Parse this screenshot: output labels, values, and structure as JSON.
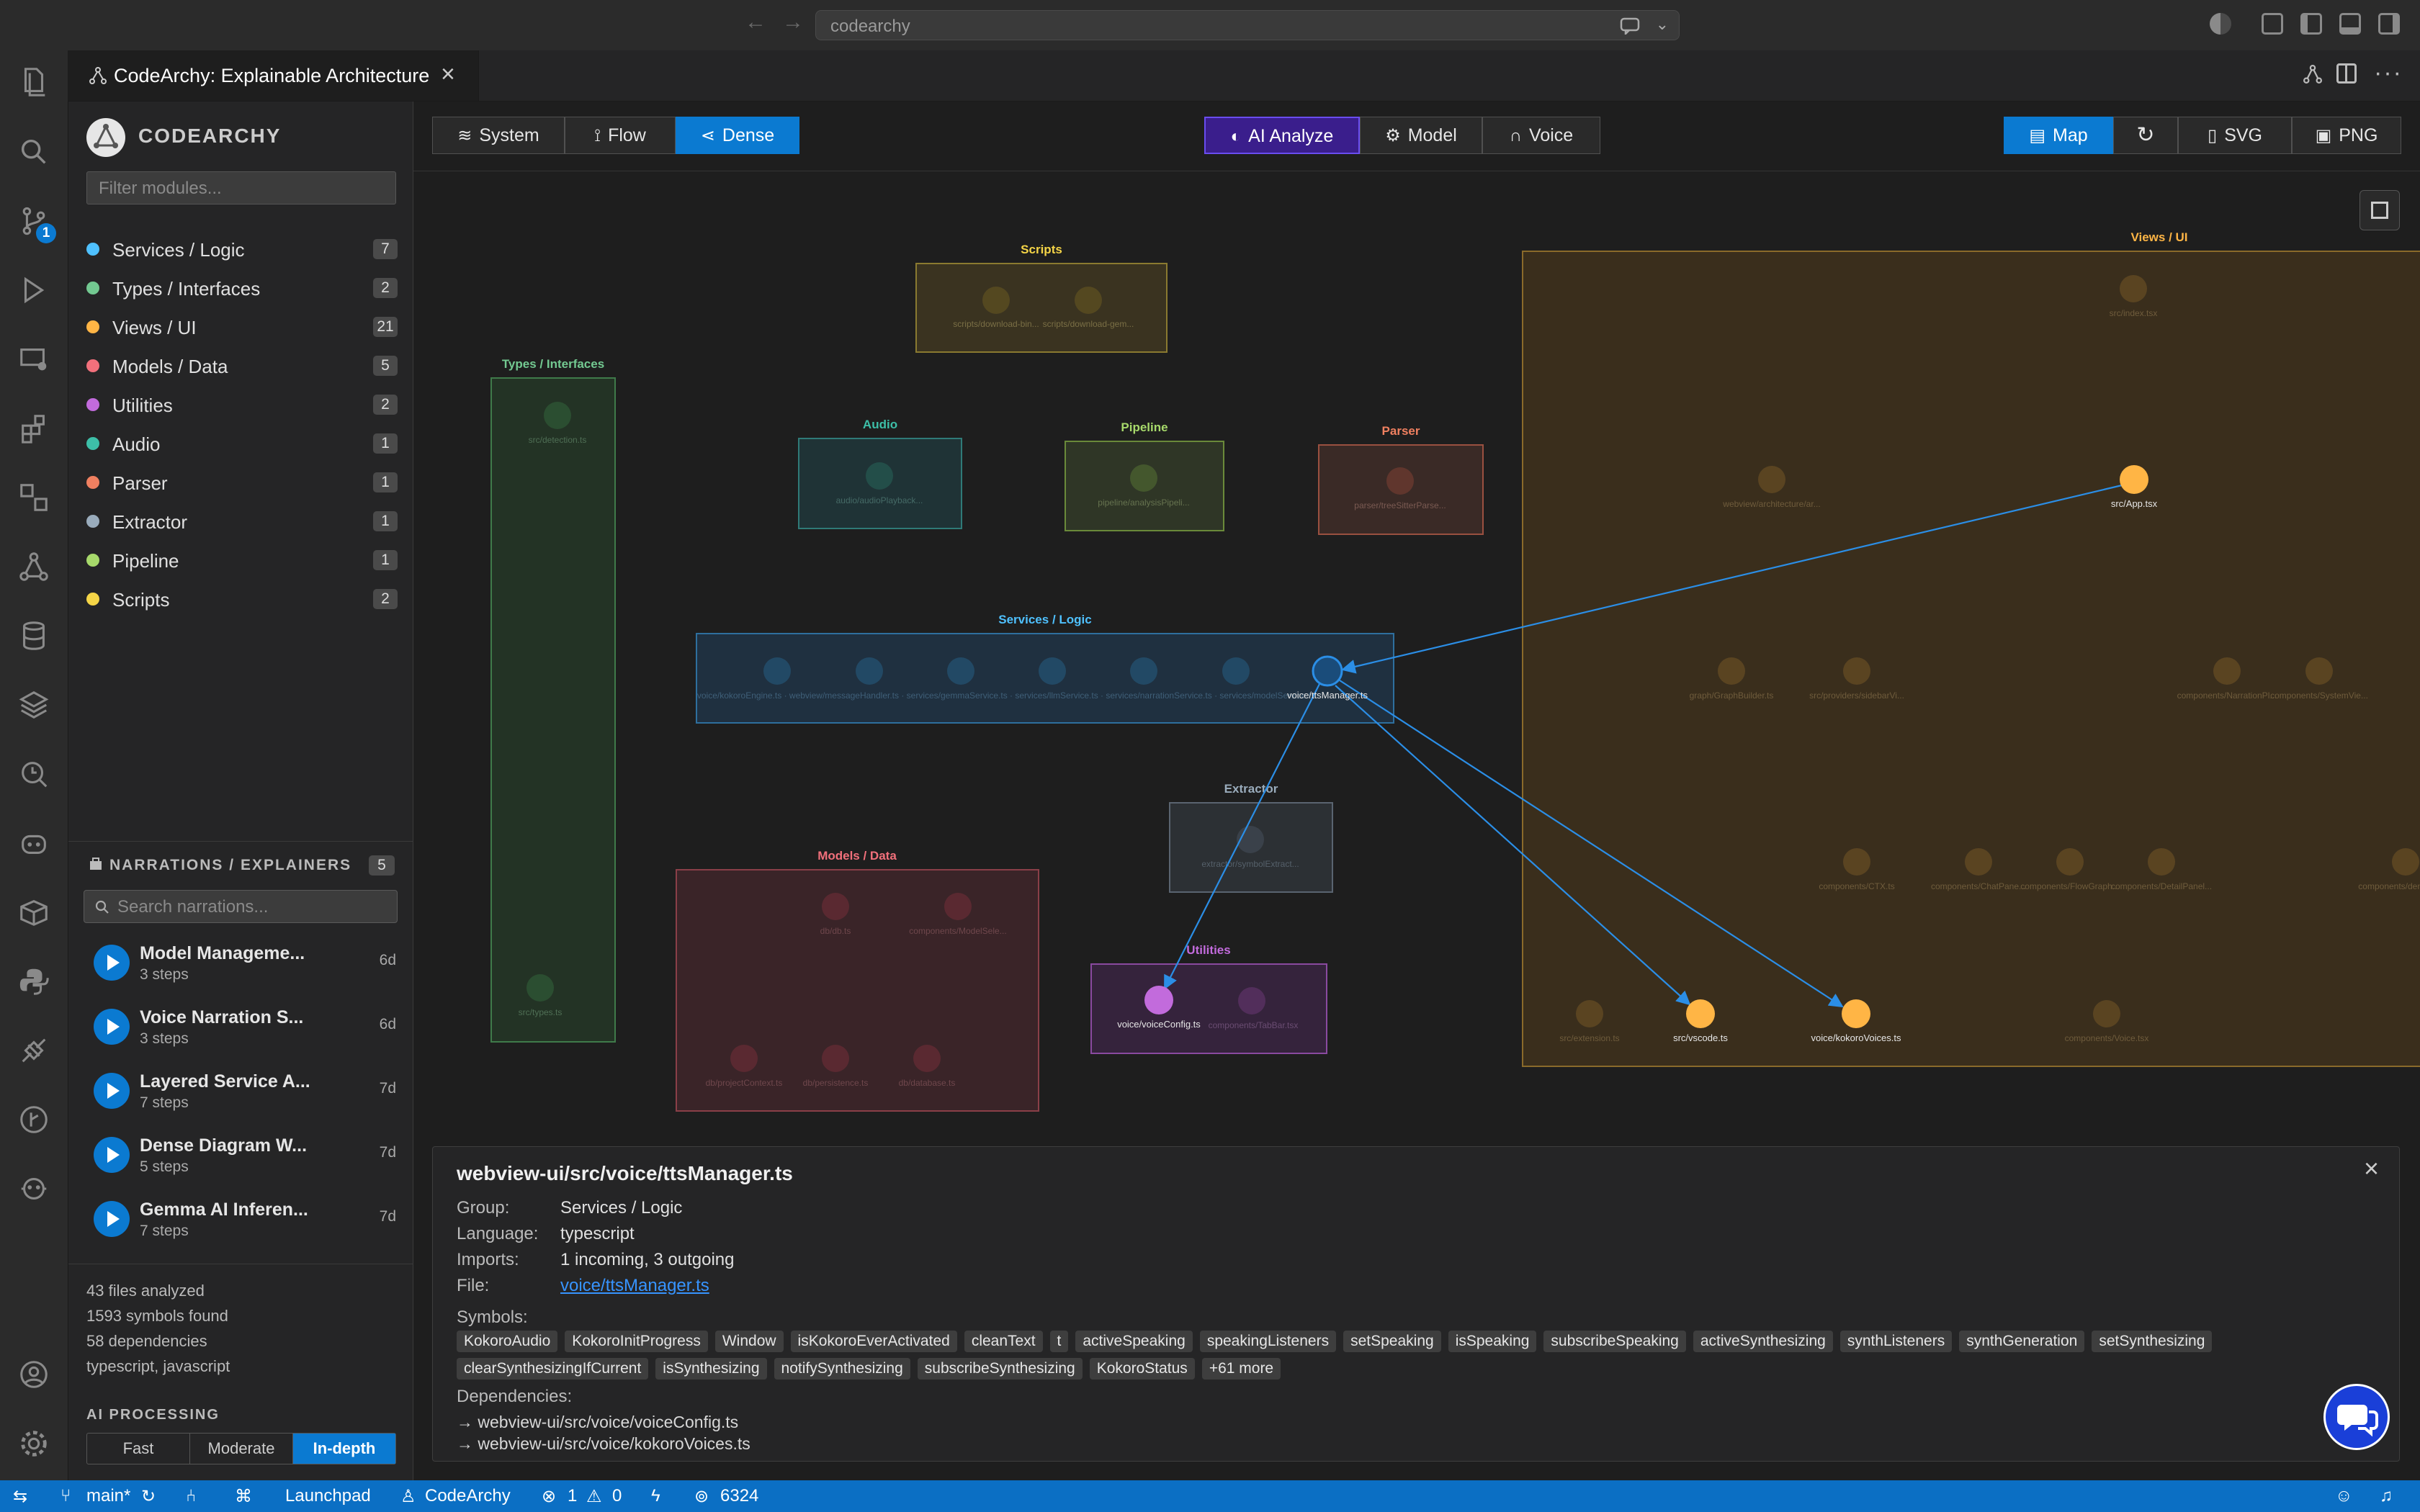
{
  "titlebar": {
    "search_text": "codearchy"
  },
  "tab": {
    "title": "CodeArchy: Explainable Architecture"
  },
  "sidebar": {
    "brand": "CODEARCHY",
    "filter_placeholder": "Filter modules...",
    "groups": [
      {
        "label": "Services / Logic",
        "count": "7",
        "color": "#4fc1ff"
      },
      {
        "label": "Types / Interfaces",
        "count": "2",
        "color": "#73c991"
      },
      {
        "label": "Views / UI",
        "count": "21",
        "color": "#ffb545"
      },
      {
        "label": "Models / Data",
        "count": "5",
        "color": "#f1707b"
      },
      {
        "label": "Utilities",
        "count": "2",
        "color": "#c26bdc"
      },
      {
        "label": "Audio",
        "count": "1",
        "color": "#3dbfa8"
      },
      {
        "label": "Parser",
        "count": "1",
        "color": "#f08060"
      },
      {
        "label": "Extractor",
        "count": "1",
        "color": "#9aacbc"
      },
      {
        "label": "Pipeline",
        "count": "1",
        "color": "#a7d96b"
      },
      {
        "label": "Scripts",
        "count": "2",
        "color": "#f5d547"
      }
    ],
    "narrations_title": "NARRATIONS / EXPLAINERS",
    "narrations_count": "5",
    "narrations_search_placeholder": "Search narrations...",
    "narrations": [
      {
        "title": "Model Manageme...",
        "steps": "3 steps",
        "age": "6d"
      },
      {
        "title": "Voice Narration S...",
        "steps": "3 steps",
        "age": "6d"
      },
      {
        "title": "Layered Service A...",
        "steps": "7 steps",
        "age": "7d"
      },
      {
        "title": "Dense Diagram W...",
        "steps": "5 steps",
        "age": "7d"
      },
      {
        "title": "Gemma AI Inferen...",
        "steps": "7 steps",
        "age": "7d"
      }
    ],
    "stats": [
      "43 files analyzed",
      "1593 symbols found",
      "58 dependencies",
      "typescript, javascript"
    ],
    "ai_processing_title": "AI PROCESSING",
    "ai_modes": [
      "Fast",
      "Moderate",
      "In-depth"
    ],
    "ai_mode_selected": "In-depth"
  },
  "toolbar": {
    "views": [
      "System",
      "Flow",
      "Dense"
    ],
    "view_selected": "Dense",
    "ai_analyze": "AI Analyze",
    "model": "Model",
    "voice": "Voice",
    "map": "Map",
    "svg": "SVG",
    "png": "PNG"
  },
  "diagram": {
    "groups": {
      "scripts": "Scripts",
      "types": "Types / Interfaces",
      "audio": "Audio",
      "pipeline": "Pipeline",
      "parser": "Parser",
      "services": "Services / Logic",
      "extractor": "Extractor",
      "models": "Models / Data",
      "utilities": "Utilities",
      "views": "Views / UI"
    },
    "nodes": {
      "tts_manager": "voice/ttsManager.ts",
      "voice_config": "voice/voiceConfig.ts",
      "app": "src/App.tsx",
      "vscode": "src/vscode.ts",
      "kokoro_voices": "voice/kokoroVoices.ts"
    },
    "faint_labels": {
      "types_1": "src/detection.ts",
      "types_2": "src/types.ts",
      "scripts_1": "scripts/download-bin...",
      "scripts_2": "scripts/download-gem...",
      "audio_1": "audio/audioPlayback...",
      "pipeline_1": "pipeline/analysisPipeli...",
      "parser_1": "parser/treeSitterParse...",
      "services_row": "voice/kokoroEngine.ts · webview/messageHandler.ts · services/gemmaService.ts · services/llmService.ts · services/narrationService.ts · services/modelService.ts",
      "extractor_1": "extractor/symbolExtract...",
      "models_1": "db/db.ts",
      "models_2": "components/ModelSele...",
      "models_3": "db/projectContext.ts",
      "models_4": "db/persistence.ts",
      "models_5": "db/database.ts",
      "utilities_2": "components/TabBar.tsx",
      "views_1": "src/index.tsx",
      "views_2": "webview/architecture/ar...",
      "views_3": "graph/GraphBuilder.ts",
      "views_4": "src/providers/sidebarVi...",
      "views_5": "components/NarrationPl...",
      "views_6": "components/SystemVie...",
      "views_7": "components/CTX.ts",
      "views_8": "components/ChatPane...",
      "views_9": "components/FlowGraph...",
      "views_10": "components/DetailPanel...",
      "views_11": "components/dense...",
      "views_12": "src/extension.ts",
      "views_13": "components/Voice.tsx"
    }
  },
  "detail": {
    "title": "webview-ui/src/voice/ttsManager.ts",
    "labels": {
      "group": "Group:",
      "language": "Language:",
      "imports": "Imports:",
      "file": "File:"
    },
    "group": "Services / Logic",
    "language": "typescript",
    "imports": "1 incoming, 3 outgoing",
    "file": "voice/ttsManager.ts",
    "symbols_title": "Symbols:",
    "symbols": [
      "KokoroAudio",
      "KokoroInitProgress",
      "Window",
      "isKokoroEverActivated",
      "cleanText",
      "t",
      "activeSpeaking",
      "speakingListeners",
      "setSpeaking",
      "isSpeaking",
      "subscribeSpeaking",
      "activeSynthesizing",
      "synthListeners",
      "synthGeneration",
      "setSynthesizing",
      "clearSynthesizingIfCurrent",
      "isSynthesizing",
      "notifySynthesizing",
      "subscribeSynthesizing",
      "KokoroStatus",
      "+61 more"
    ],
    "dependencies_title": "Dependencies:",
    "dependencies": [
      "→ webview-ui/src/voice/voiceConfig.ts",
      "→ webview-ui/src/voice/kokoroVoices.ts"
    ]
  },
  "statusbar": {
    "branch": "main*",
    "launchpad": "Launchpad",
    "extension": "CodeArchy",
    "errors": "1",
    "warnings": "0",
    "port": "6324"
  }
}
